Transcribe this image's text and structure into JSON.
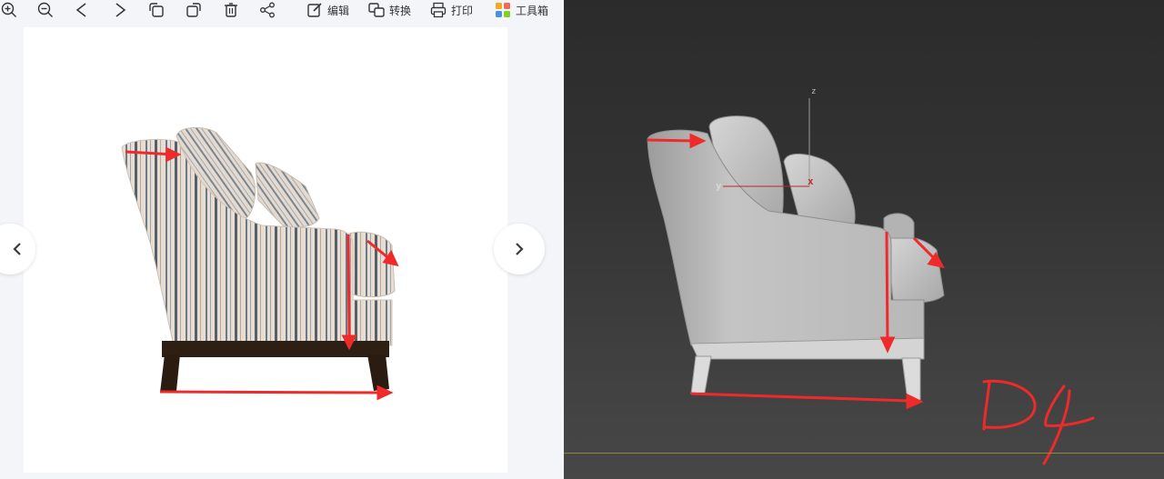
{
  "toolbar": {
    "icons": [
      "zoom-in-icon",
      "zoom-out-icon",
      "prev-icon",
      "next-icon",
      "rotate-left-icon",
      "rotate-right-icon",
      "trash-icon",
      "share-icon"
    ],
    "edit_label": "编辑",
    "convert_label": "转换",
    "print_label": "打印",
    "toolbox_label": "工具箱"
  },
  "viewport": {
    "axis_z": "z",
    "axis_y": "y",
    "axis_x": "x",
    "annotation": "D4"
  },
  "colors": {
    "accent_red": "#ee2a2a",
    "viewport_bg": "#333333",
    "ground_line": "#8f8a3a"
  }
}
